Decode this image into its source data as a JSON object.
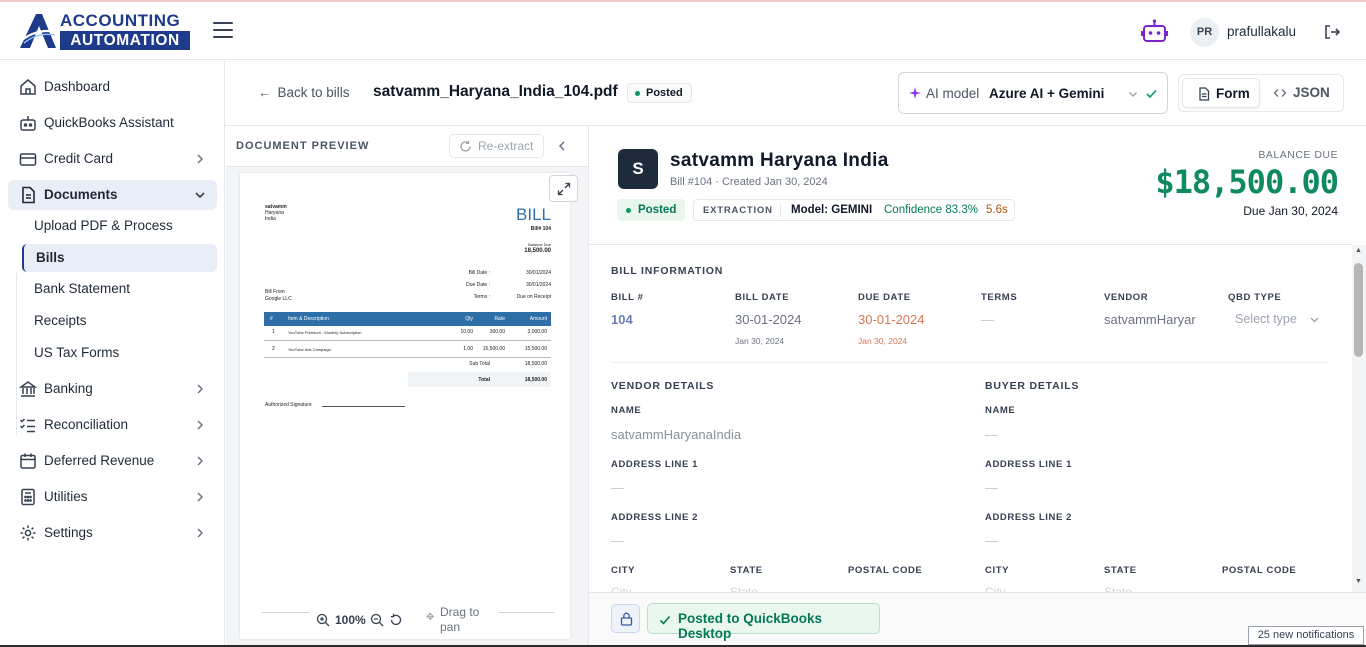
{
  "brand": {
    "line1": "ACCOUNTING",
    "line2": "AUTOMATION"
  },
  "user": {
    "initials": "PR",
    "name": "prafullakalu"
  },
  "sidebar": {
    "items": [
      {
        "label": "Dashboard"
      },
      {
        "label": "QuickBooks Assistant"
      },
      {
        "label": "Credit Card"
      },
      {
        "label": "Documents"
      },
      {
        "label": "Banking"
      },
      {
        "label": "Reconciliation"
      },
      {
        "label": "Deferred Revenue"
      },
      {
        "label": "Utilities"
      },
      {
        "label": "Settings"
      }
    ],
    "documents_sub": [
      {
        "label": "Upload PDF & Process"
      },
      {
        "label": "Bills"
      },
      {
        "label": "Bank Statement"
      },
      {
        "label": "Receipts"
      },
      {
        "label": "US Tax Forms"
      }
    ]
  },
  "header": {
    "back": "Back to bills",
    "filename": "satvamm_Haryana_India_104.pdf",
    "status": "Posted",
    "ai_label": "AI model",
    "ai_value": "Azure AI + Gemini",
    "view_form": "Form",
    "view_json": "JSON"
  },
  "preview": {
    "title": "DOCUMENT PREVIEW",
    "reextract": "Re-extract",
    "zoom": "100%",
    "drag": "Drag to",
    "pan": "pan",
    "doc": {
      "from_name": "satvamm",
      "from_l2": "Haryana",
      "from_l3": "India",
      "heading": "BILL",
      "bill_no": "Bill# 104",
      "balance_lbl": "Balance Due",
      "balance_val": "18,500.00",
      "bill_date_lbl": "Bill Date :",
      "bill_date": "30/01/2024",
      "due_date_lbl": "Due Date :",
      "due_date": "30/01/2024",
      "terms_lbl": "Terms :",
      "terms": "Due on Receipt",
      "bill_from": "Bill From",
      "bill_from_name": "Google LLC",
      "cols": [
        "#",
        "Item & Description",
        "Qty",
        "Rate",
        "Amount"
      ],
      "rows": [
        [
          "1",
          "YouTube Premium - Monthly Subscription",
          "10.00",
          "300.00",
          "3,000.00"
        ],
        [
          "2",
          "YouTube Ads Campaign",
          "1.00",
          "15,500.00",
          "15,500.00"
        ]
      ],
      "subtotal_lbl": "Sub Total",
      "subtotal": "18,500.00",
      "total_lbl": "Total",
      "total": "18,500.00",
      "signature": "Authorized Signature"
    }
  },
  "bill": {
    "avatar": "S",
    "vendor_title": "satvamm Haryana India",
    "subtitle": "Bill #104 · Created Jan 30, 2024",
    "status": "Posted",
    "extraction": "EXTRACTION",
    "model": "Model: GEMINI",
    "confidence": "Confidence 83.3%",
    "time": "5.6s",
    "balance_label": "BALANCE DUE",
    "balance": "$18,500.00",
    "due": "Due Jan 30, 2024"
  },
  "info": {
    "section": "BILL INFORMATION",
    "labels": [
      "BILL #",
      "BILL DATE",
      "DUE DATE",
      "TERMS",
      "VENDOR",
      "QBD TYPE"
    ],
    "bill_no": "104",
    "bill_date": "30-01-2024",
    "bill_date_sub": "Jan 30, 2024",
    "due_date": "30-01-2024",
    "due_date_sub": "Jan 30, 2024",
    "terms": "—",
    "vendor": "satvammHaryar",
    "qbd_placeholder": "Select type"
  },
  "vendor": {
    "section": "VENDOR DETAILS",
    "name_lbl": "NAME",
    "name": "satvammHaryanaIndia",
    "addr1_lbl": "ADDRESS LINE 1",
    "addr2_lbl": "ADDRESS LINE 2",
    "city_lbl": "CITY",
    "state_lbl": "STATE",
    "postal_lbl": "POSTAL CODE",
    "empty": "—",
    "city_ph": "City",
    "state_ph": "State"
  },
  "buyer": {
    "section": "BUYER DETAILS",
    "name_lbl": "NAME",
    "addr1_lbl": "ADDRESS LINE 1",
    "addr2_lbl": "ADDRESS LINE 2",
    "city_lbl": "CITY",
    "state_lbl": "STATE",
    "postal_lbl": "POSTAL CODE",
    "empty": "—",
    "city_ph": "City",
    "state_ph": "State"
  },
  "footer": {
    "posted": "Posted to QuickBooks Desktop"
  },
  "notifications": "25 new notifications",
  "colors": {
    "brand": "#1e3a8a",
    "success": "#0f8a5f",
    "due": "#d97757"
  }
}
